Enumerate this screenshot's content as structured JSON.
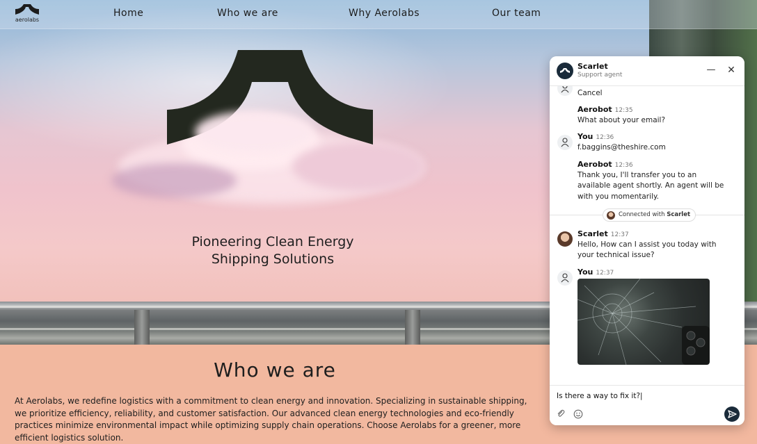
{
  "nav": {
    "brand": "aerolabs",
    "links": [
      "Home",
      "Who we are",
      "Why Aerolabs",
      "Our team"
    ]
  },
  "hero": {
    "tagline_line1": "Pioneering Clean Energy",
    "tagline_line2": "Shipping Solutions"
  },
  "about": {
    "title": "Who we are",
    "body": "At Aerolabs, we redefine logistics with a commitment to clean energy and innovation. Specializing in sustainable shipping, we prioritize efficiency, reliability, and customer satisfaction. Our advanced clean energy technologies and eco-friendly practices minimize environmental impact while optimizing supply chain operations. Choose Aerolabs for a greener, more efficient logistics solution."
  },
  "chat": {
    "agent_name": "Scarlet",
    "agent_role": "Support agent",
    "messages": [
      {
        "sender": "",
        "time": "",
        "text": "Cancel"
      },
      {
        "sender": "Aerobot",
        "time": "12:35",
        "text": "What about your email?"
      },
      {
        "sender": "You",
        "time": "12:36",
        "text": "f.baggins@theshire.com"
      },
      {
        "sender": "Aerobot",
        "time": "12:36",
        "text": "Thank you, I'll transfer you to an available agent shortly. An agent will be with you momentarily."
      },
      {
        "sender": "Scarlet",
        "time": "12:37",
        "text": "Hello, How can I assist you today with your technical issue?"
      },
      {
        "sender": "You",
        "time": "12:37",
        "text": ""
      }
    ],
    "separator_prefix": "Connected with",
    "separator_name": "Scarlet",
    "composer_value": "Is there a way to fix it?|"
  },
  "colors": {
    "accent": "#1a2b3a",
    "about_bg": "#f2b89f"
  }
}
